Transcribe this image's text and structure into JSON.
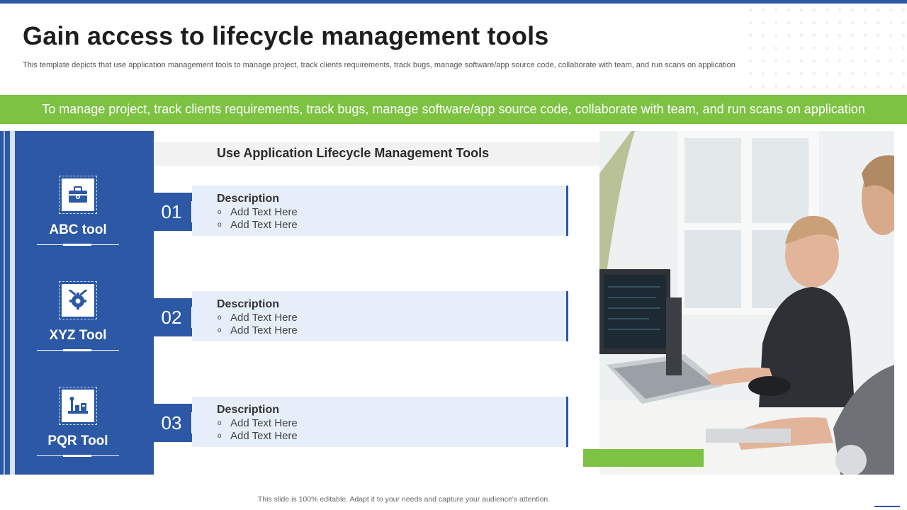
{
  "slide": {
    "title": "Gain access to lifecycle management tools",
    "subtitle": "This template depicts that use application management tools to manage project, track clients requirements, track bugs, manage software/app source code, collaborate with team, and run scans on application",
    "banner": "To manage project, track clients requirements, track bugs, manage software/app source code, collaborate with team, and run scans on application",
    "section_heading": "Use Application Lifecycle Management Tools",
    "footer": "This slide is 100% editable.  Adapt it to your needs and capture your audience's attention."
  },
  "tools": [
    {
      "label": "ABC tool",
      "icon": "toolbox-icon"
    },
    {
      "label": "XYZ Tool",
      "icon": "gear-wrench-icon"
    },
    {
      "label": "PQR Tool",
      "icon": "tools-icon"
    }
  ],
  "items": [
    {
      "number": "01",
      "title": "Description",
      "lines": [
        "Add Text Here",
        "Add Text Here"
      ]
    },
    {
      "number": "02",
      "title": "Description",
      "lines": [
        "Add Text Here",
        "Add Text Here"
      ]
    },
    {
      "number": "03",
      "title": "Description",
      "lines": [
        "Add Text Here",
        "Add Text Here"
      ]
    }
  ],
  "bullet_glyph": "o",
  "colors": {
    "primary_blue": "#2c58a6",
    "accent_green": "#7dc242",
    "card_fill": "#e6eef9"
  },
  "photo": {
    "description_icon": "office-workers-photo"
  }
}
